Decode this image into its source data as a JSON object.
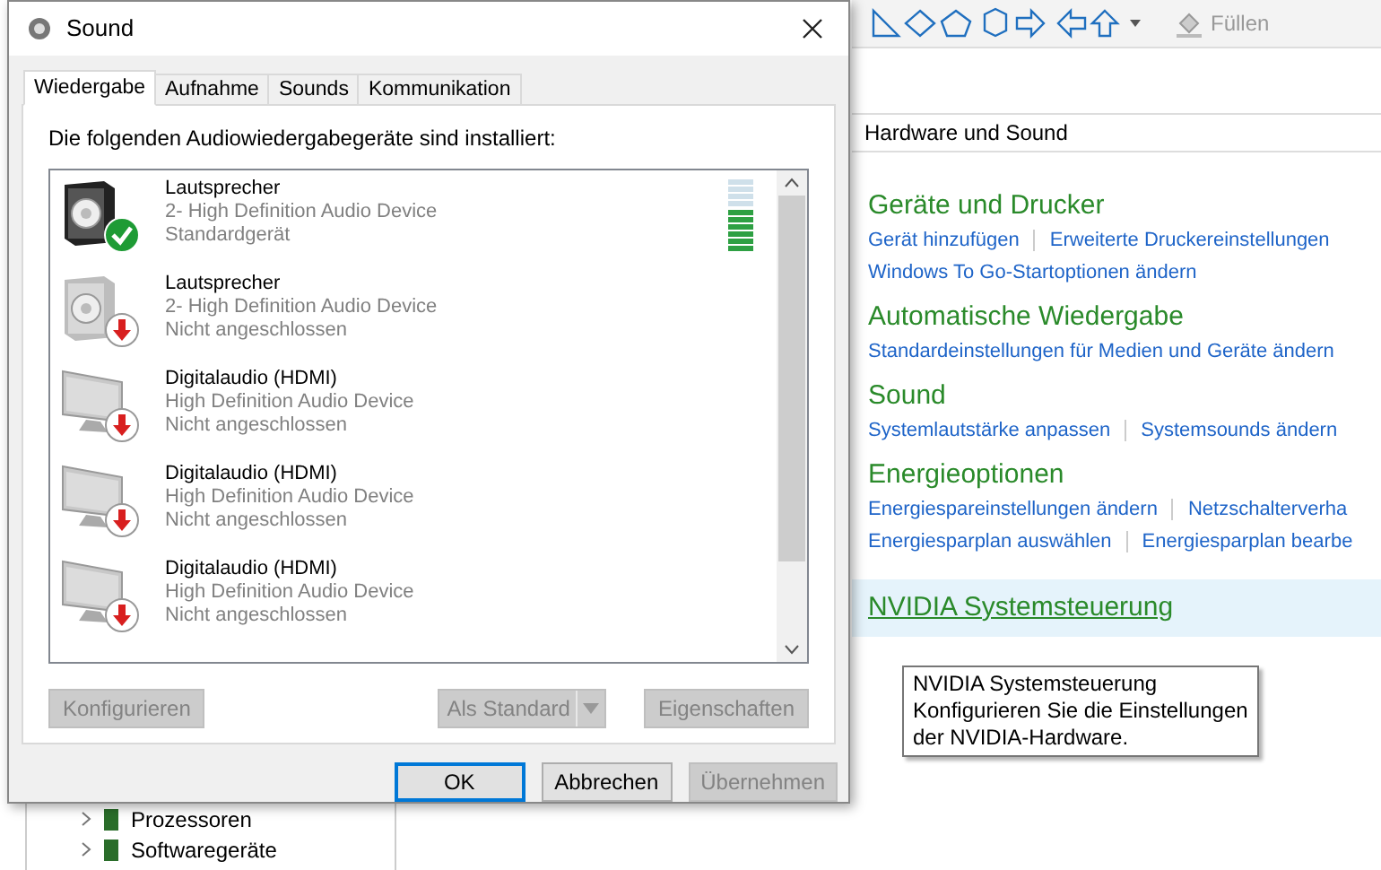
{
  "window": {
    "title": "Sound"
  },
  "tabs": [
    {
      "label": "Wiedergabe",
      "selected": true
    },
    {
      "label": "Aufnahme",
      "selected": false
    },
    {
      "label": "Sounds",
      "selected": false
    },
    {
      "label": "Kommunikation",
      "selected": false
    }
  ],
  "list_label": "Die folgenden Audiowiedergabegeräte sind installiert:",
  "devices": [
    {
      "kind": "speaker",
      "name": "Lautsprecher",
      "driver": "2- High Definition Audio Device",
      "status": "Standardgerät",
      "default": true,
      "meter": {
        "level": 0.6
      }
    },
    {
      "kind": "speaker",
      "name": "Lautsprecher",
      "driver": "2- High Definition Audio Device",
      "status": "Nicht angeschlossen",
      "default": false
    },
    {
      "kind": "monitor",
      "name": "Digitalaudio (HDMI)",
      "driver": "High Definition Audio Device",
      "status": "Nicht angeschlossen",
      "default": false
    },
    {
      "kind": "monitor",
      "name": "Digitalaudio (HDMI)",
      "driver": "High Definition Audio Device",
      "status": "Nicht angeschlossen",
      "default": false
    },
    {
      "kind": "monitor",
      "name": "Digitalaudio (HDMI)",
      "driver": "High Definition Audio Device",
      "status": "Nicht angeschlossen",
      "default": false
    }
  ],
  "list_buttons": [
    {
      "label": "Konfigurieren",
      "disabled": true,
      "kind": "plain"
    },
    {
      "label": "Als Standard",
      "disabled": true,
      "kind": "split"
    },
    {
      "label": "Eigenschaften",
      "disabled": true,
      "kind": "plain"
    }
  ],
  "dialog_buttons": [
    {
      "label": "OK",
      "disabled": false,
      "focused": true
    },
    {
      "label": "Abbrechen",
      "disabled": false,
      "focused": false
    },
    {
      "label": "Übernehmen",
      "disabled": true,
      "focused": false
    }
  ],
  "ribbon": {
    "fill_label": "Füllen"
  },
  "control_panel": {
    "breadcrumb": "Hardware und Sound",
    "sections": [
      {
        "title": "Geräte und Drucker",
        "hovered": false,
        "link_rows": [
          [
            "Gerät hinzufügen",
            "Erweiterte Druckereinstellungen"
          ],
          [
            "Windows To Go-Startoptionen ändern"
          ]
        ]
      },
      {
        "title": "Automatische Wiedergabe",
        "hovered": false,
        "link_rows": [
          [
            "Standardeinstellungen für Medien und Geräte ändern"
          ]
        ]
      },
      {
        "title": "Sound",
        "hovered": false,
        "link_rows": [
          [
            "Systemlautstärke anpassen",
            "Systemsounds ändern"
          ]
        ]
      },
      {
        "title": "Energieoptionen",
        "hovered": false,
        "link_rows": [
          [
            "Energiespareinstellungen ändern",
            "Netzschalterverha"
          ],
          [
            "Energiesparplan auswählen",
            "Energiesparplan bearbe"
          ]
        ]
      },
      {
        "title": "NVIDIA Systemsteuerung",
        "hovered": true
      }
    ]
  },
  "tooltip": {
    "lines": [
      "NVIDIA Systemsteuerung",
      "Konfigurieren Sie die Einstellungen",
      "der NVIDIA-Hardware."
    ]
  },
  "device_tree": [
    {
      "label": "Prozessoren"
    },
    {
      "label": "Softwaregeräte"
    }
  ]
}
